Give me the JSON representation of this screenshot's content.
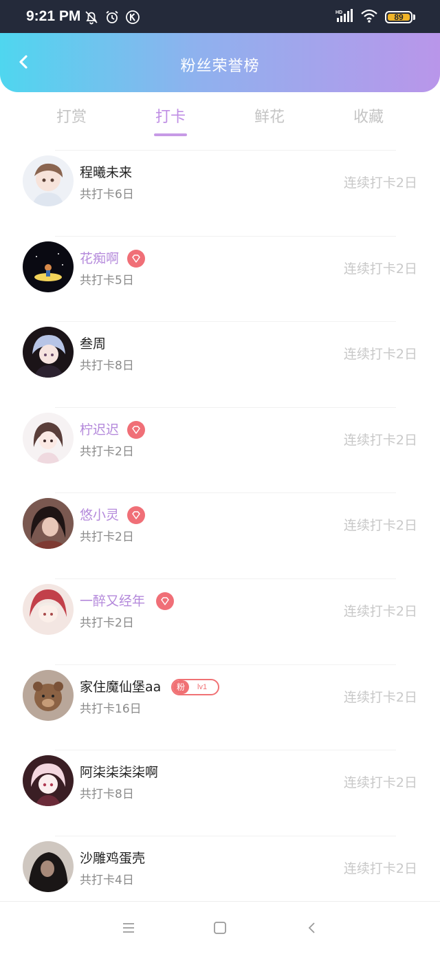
{
  "status_bar": {
    "time": "9:21 PM",
    "battery": "89",
    "icons": [
      "mute-bell-icon",
      "alarm-icon",
      "k-icon",
      "signal-icon",
      "wifi-icon",
      "battery-icon"
    ]
  },
  "header": {
    "title": "粉丝荣誉榜",
    "back_icon": "chevron-left-icon"
  },
  "tabs": [
    {
      "label": "打赏",
      "active": false
    },
    {
      "label": "打卡",
      "active": true
    },
    {
      "label": "鲜花",
      "active": false
    },
    {
      "label": "收藏",
      "active": false
    }
  ],
  "list": [
    {
      "name": "程曦未来",
      "vip": false,
      "badge": "",
      "total": "共打卡6日",
      "streak": "连续打卡2日"
    },
    {
      "name": "花痴啊",
      "vip": true,
      "badge": "vip-diamond-icon",
      "total": "共打卡5日",
      "streak": "连续打卡2日"
    },
    {
      "name": "叁周",
      "vip": false,
      "badge": "",
      "total": "共打卡8日",
      "streak": "连续打卡2日"
    },
    {
      "name": "柠迟迟",
      "vip": true,
      "badge": "vip-diamond-icon",
      "total": "共打卡2日",
      "streak": "连续打卡2日"
    },
    {
      "name": "悠小灵",
      "vip": true,
      "badge": "vip-diamond-icon",
      "total": "共打卡2日",
      "streak": "连续打卡2日"
    },
    {
      "name": "一醉又经年",
      "vip": true,
      "badge": "vip-diamond-icon",
      "total": "共打卡2日",
      "streak": "连续打卡2日"
    },
    {
      "name": "家住魔仙堡aa",
      "vip": false,
      "badge": "fan-level",
      "fan_label": "粉",
      "fan_level": "lv1",
      "total": "共打卡16日",
      "streak": "连续打卡2日"
    },
    {
      "name": "阿柒柒柒柒啊",
      "vip": false,
      "badge": "",
      "total": "共打卡8日",
      "streak": "连续打卡2日"
    },
    {
      "name": "沙雕鸡蛋壳",
      "vip": false,
      "badge": "",
      "total": "共打卡4日",
      "streak": "连续打卡2日"
    }
  ],
  "colors": {
    "header_gradient": [
      "#4fd6ef",
      "#b996ea"
    ],
    "active_tab": "#bf8ee4",
    "vip_name": "#b489db",
    "badge": "#f06f77",
    "muted_text": "#c8c8c8"
  },
  "nav_bar": {
    "icons": [
      "menu-icon",
      "home-square-icon",
      "back-triangle-icon"
    ]
  }
}
